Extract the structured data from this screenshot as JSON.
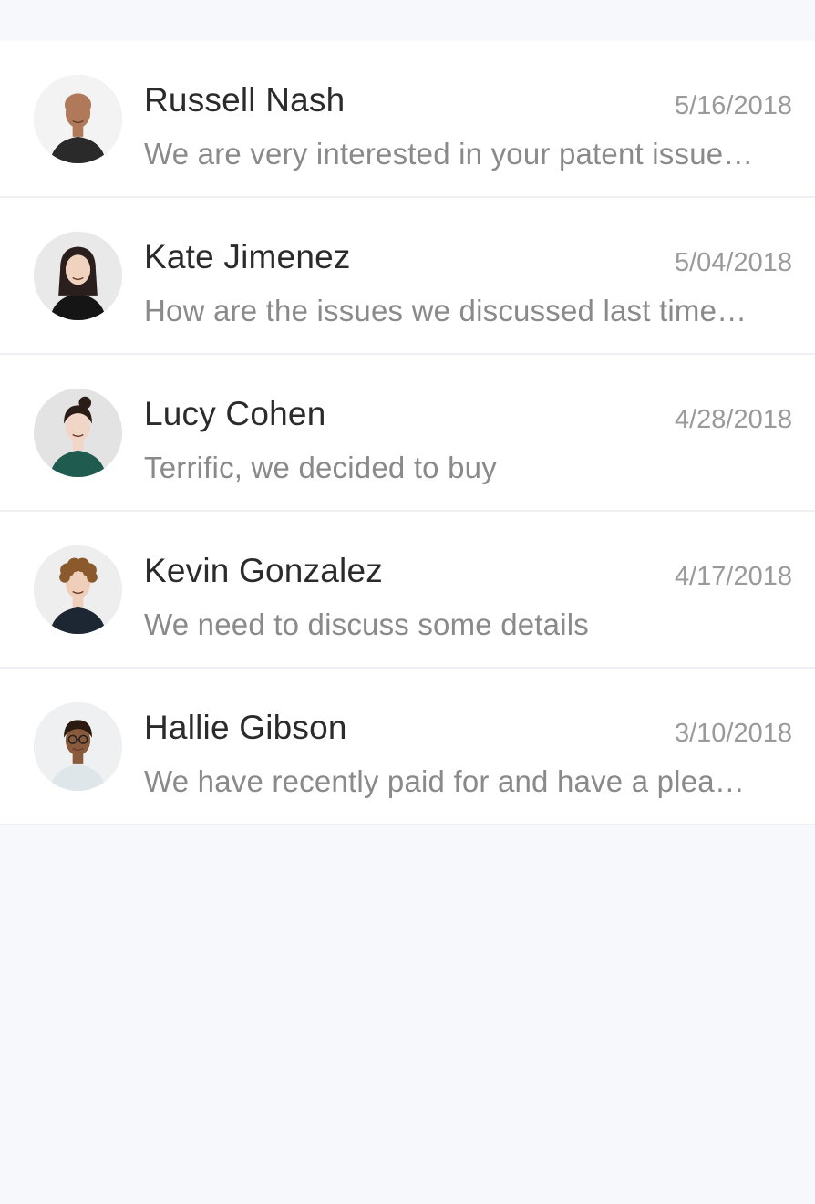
{
  "conversations": [
    {
      "name": "Russell Nash",
      "date": "5/16/2018",
      "preview": "We are very interested in your patent issue…",
      "avatar": {
        "skin": "#b07a5a",
        "hair": "#3a2a22",
        "shirt": "#2a2a2a",
        "bg": "#f3f3f3",
        "style": "bald"
      }
    },
    {
      "name": "Kate Jimenez",
      "date": "5/04/2018",
      "preview": "How are the issues we discussed last time…",
      "avatar": {
        "skin": "#f0d2bf",
        "hair": "#2a1f1c",
        "shirt": "#151515",
        "bg": "#e9e9e9",
        "style": "long"
      }
    },
    {
      "name": "Lucy Cohen",
      "date": "4/28/2018",
      "preview": "Terrific, we decided to buy",
      "avatar": {
        "skin": "#f1d6c8",
        "hair": "#2a1d18",
        "shirt": "#1f5b4e",
        "bg": "#e3e3e3",
        "style": "bun"
      }
    },
    {
      "name": "Kevin Gonzalez",
      "date": "4/17/2018",
      "preview": "We need to discuss some details",
      "avatar": {
        "skin": "#efcfb9",
        "hair": "#8a5a2c",
        "shirt": "#1c2733",
        "bg": "#eeeeee",
        "style": "curly"
      }
    },
    {
      "name": "Hallie Gibson",
      "date": "3/10/2018",
      "preview": "We have recently paid for and have a plea…",
      "avatar": {
        "skin": "#8a5a3c",
        "hair": "#2a1a12",
        "shirt": "#dfe6ea",
        "bg": "#eef0f2",
        "style": "glasses"
      }
    }
  ]
}
